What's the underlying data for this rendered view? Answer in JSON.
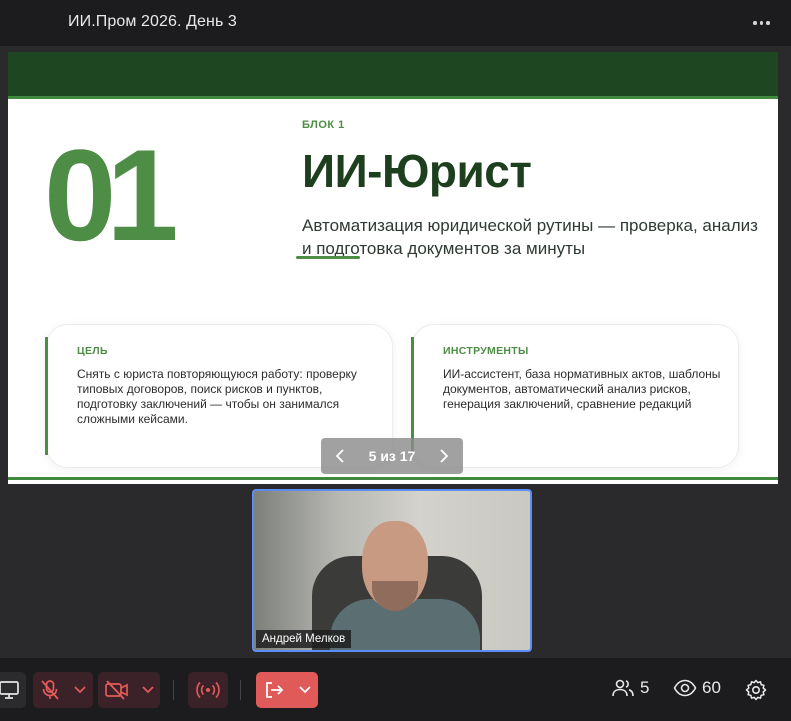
{
  "header": {
    "title": "ИИ.Пром 2026. День 3",
    "more_icon": "more-horizontal-icon"
  },
  "slide": {
    "big_number": "01",
    "block_label": "БЛОК 1",
    "heading": "ИИ-Юрист",
    "subtitle": "Автоматизация юридической рутины — проверка, анализ и подготовка документов за минуты",
    "cards": [
      {
        "title": "ЦЕЛЬ",
        "text": "Снять с юриста повторяющуюся работу: проверку типовых договоров, поиск рисков и пунктов, подготовку заключений — чтобы он занимался сложными кейсами."
      },
      {
        "title": "ИНСТРУМЕНТЫ",
        "text": "ИИ-ассистент, база нормативных актов, шаблоны документов, автоматический анализ рисков, генерация заключений, сравнение редакций"
      }
    ],
    "accent_color": "#4e8d45",
    "band_color": "#1e4620"
  },
  "pager": {
    "text": "5 из 17",
    "current": 5,
    "total": 17
  },
  "video": {
    "participant_name": "Андрей Мелков"
  },
  "toolbar": {
    "participants_count": "5",
    "viewers_count": "60",
    "icons": [
      "screen-share-icon",
      "mic-off-icon",
      "camera-off-icon",
      "broadcast-icon",
      "leave-icon",
      "people-icon",
      "eye-icon",
      "gear-icon"
    ],
    "leave_color": "#e05a5a"
  }
}
